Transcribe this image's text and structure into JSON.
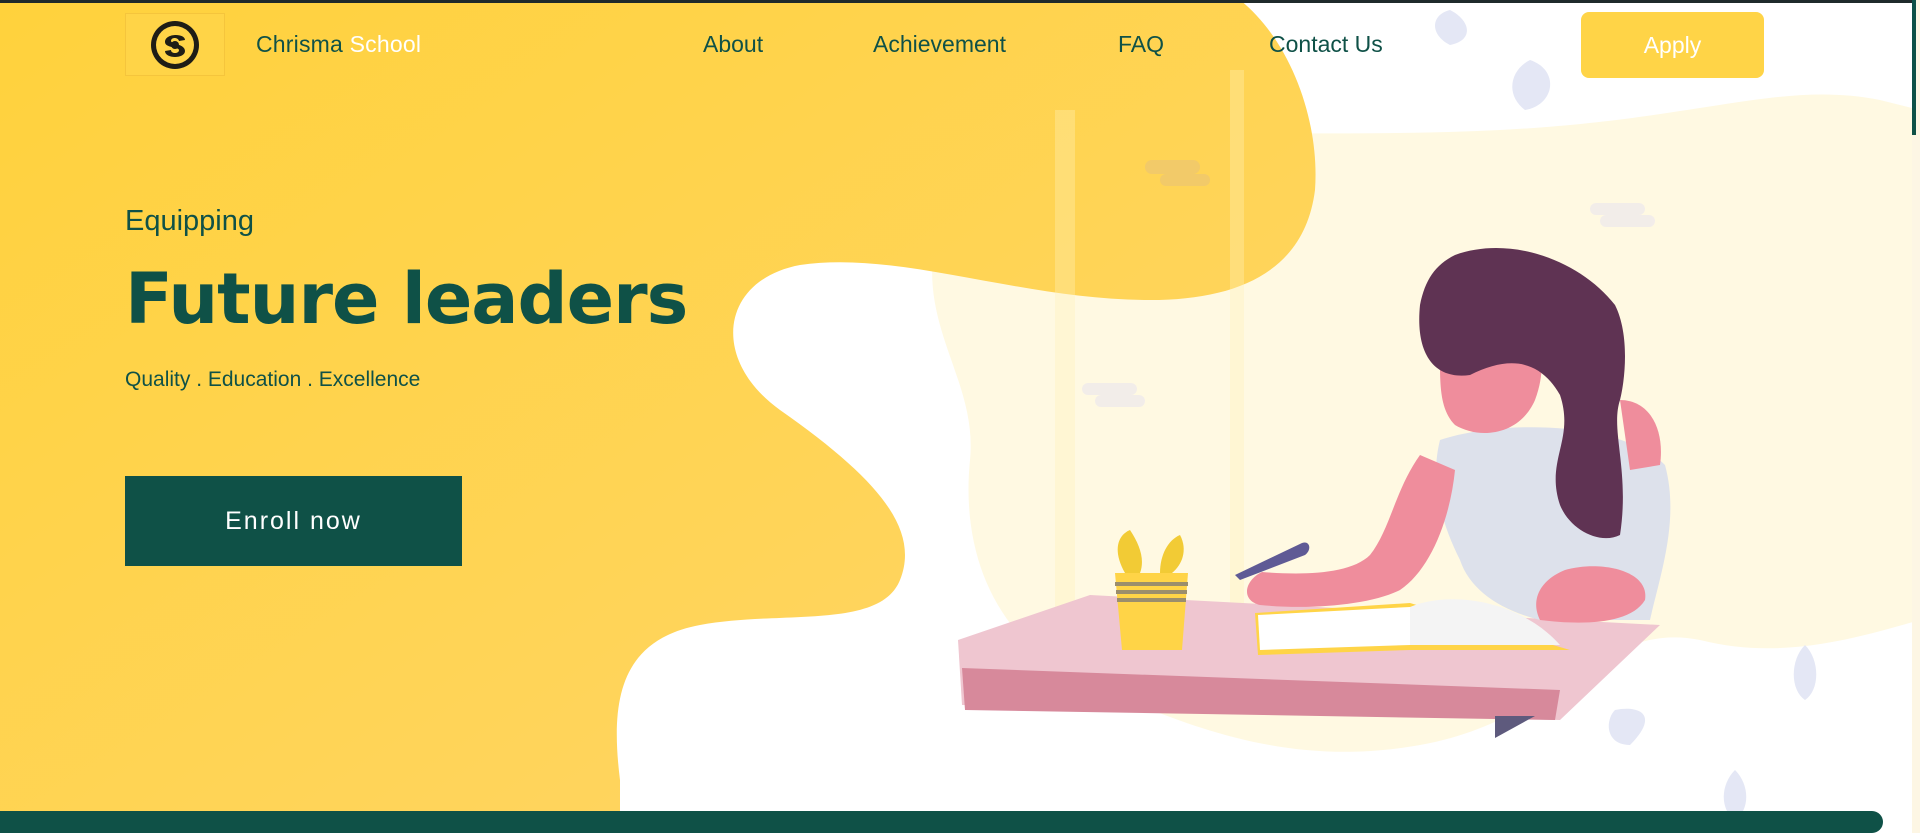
{
  "brand": {
    "logo_icon": "school-seal-icon",
    "name_part1": "Chrisma",
    "name_part2": "School"
  },
  "nav": {
    "links": [
      "About",
      "Achievement",
      "FAQ",
      "Contact Us"
    ],
    "apply_label": "Apply"
  },
  "hero": {
    "eyebrow": "Equipping",
    "headline": "Future leaders",
    "tagline": "Quality . Education . Excellence",
    "cta_label": "Enroll now"
  },
  "colors": {
    "primary": "#0f5147",
    "accent": "#ffd447",
    "accent_light": "#fff9e2",
    "white": "#ffffff"
  },
  "icons": [
    "school-seal-icon",
    "student-illustration",
    "leaf-icon"
  ]
}
